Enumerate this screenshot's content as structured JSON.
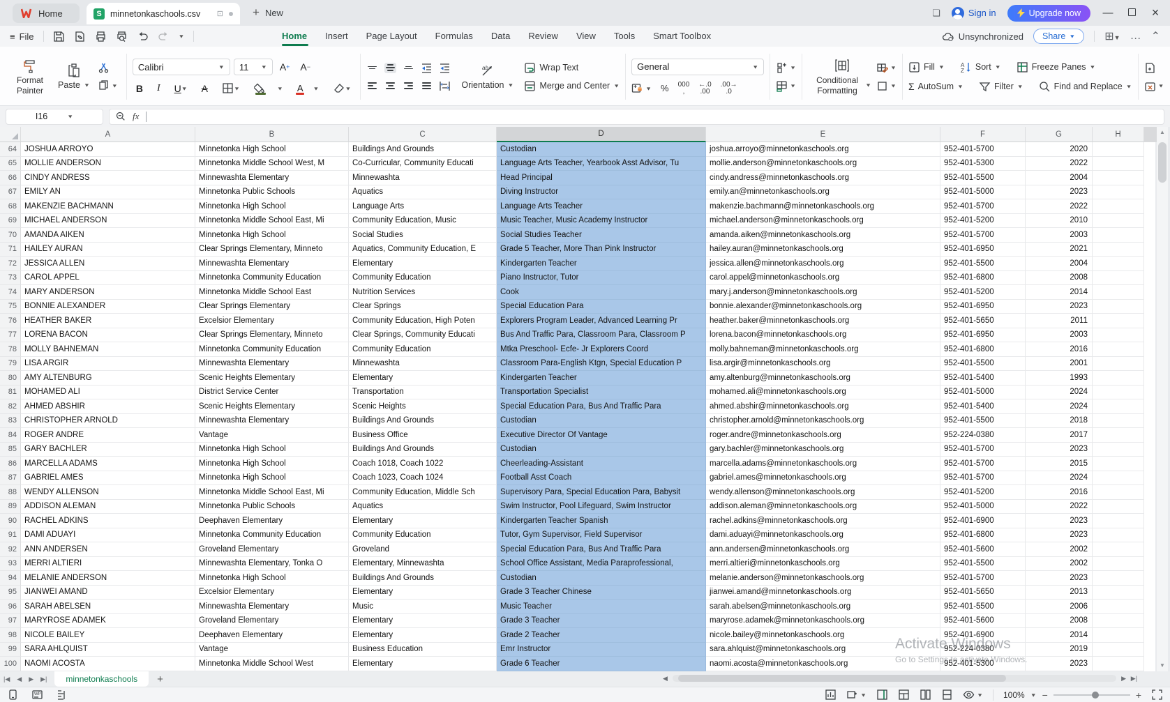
{
  "titlebar": {
    "home_tab": "Home",
    "doc_tab": "minnetonkaschools.csv",
    "new_label": "New",
    "sign_in": "Sign in",
    "upgrade": "Upgrade now"
  },
  "menubar": {
    "file": "File",
    "tabs": [
      "Home",
      "Insert",
      "Page Layout",
      "Formulas",
      "Data",
      "Review",
      "View",
      "Tools",
      "Smart Toolbox"
    ],
    "active_tab": "Home",
    "sync_status": "Unsynchronized",
    "share": "Share"
  },
  "ribbon": {
    "format_painter": "Format Painter",
    "paste": "Paste",
    "font_name": "Calibri",
    "font_size": "11",
    "orientation": "Orientation",
    "wrap_text": "Wrap Text",
    "merge_center": "Merge and Center",
    "number_format": "General",
    "percent": "%",
    "thousands": "000",
    "dec_decrease": "←.0",
    "dec_increase": ".00→",
    "conditional_formatting": "Conditional Formatting",
    "fill": "Fill",
    "autosum": "AutoSum",
    "sort": "Sort",
    "filter": "Filter",
    "freeze_panes": "Freeze Panes",
    "find_replace": "Find and Replace",
    "bold": "B",
    "italic": "I",
    "underline": "U",
    "strike": "A",
    "font_grow": "A+",
    "font_shrink": "A-",
    "sigma": "Σ"
  },
  "formula_bar": {
    "name_box": "I16"
  },
  "grid": {
    "columns": [
      "A",
      "B",
      "C",
      "D",
      "E",
      "F",
      "G",
      "H"
    ],
    "selected_column": "D",
    "rows": [
      [
        "64",
        "JOSHUA ARROYO",
        "Minnetonka High School",
        "Buildings And Grounds",
        "Custodian",
        "joshua.arroyo@minnetonkaschools.org",
        "952-401-5700",
        "2020"
      ],
      [
        "65",
        "MOLLIE ANDERSON",
        "Minnetonka Middle School West, M",
        "Co-Curricular, Community Educati",
        "Language Arts Teacher, Yearbook Asst Advisor, Tu",
        "mollie.anderson@minnetonkaschools.org",
        "952-401-5300",
        "2022"
      ],
      [
        "66",
        "CINDY ANDRESS",
        "Minnewashta Elementary",
        "Minnewashta",
        "Head Principal",
        "cindy.andress@minnetonkaschools.org",
        "952-401-5500",
        "2004"
      ],
      [
        "67",
        "EMILY AN",
        "Minnetonka Public Schools",
        "Aquatics",
        "Diving Instructor",
        "emily.an@minnetonkaschools.org",
        "952-401-5000",
        "2023"
      ],
      [
        "68",
        "MAKENZIE BACHMANN",
        "Minnetonka High School",
        "Language Arts",
        "Language Arts Teacher",
        "makenzie.bachmann@minnetonkaschools.org",
        "952-401-5700",
        "2022"
      ],
      [
        "69",
        "MICHAEL ANDERSON",
        "Minnetonka Middle School East, Mi",
        "Community Education, Music",
        "Music Teacher, Music Academy Instructor",
        "michael.anderson@minnetonkaschools.org",
        "952-401-5200",
        "2010"
      ],
      [
        "70",
        "AMANDA AIKEN",
        "Minnetonka High School",
        "Social Studies",
        "Social Studies Teacher",
        "amanda.aiken@minnetonkaschools.org",
        "952-401-5700",
        "2003"
      ],
      [
        "71",
        "HAILEY AURAN",
        "Clear Springs Elementary, Minneto",
        "Aquatics, Community Education, E",
        "Grade 5 Teacher, More Than Pink Instructor",
        "hailey.auran@minnetonkaschools.org",
        "952-401-6950",
        "2021"
      ],
      [
        "72",
        "JESSICA ALLEN",
        "Minnewashta Elementary",
        "Elementary",
        "Kindergarten Teacher",
        "jessica.allen@minnetonkaschools.org",
        "952-401-5500",
        "2004"
      ],
      [
        "73",
        "CAROL APPEL",
        "Minnetonka Community Education",
        "Community Education",
        "Piano Instructor, Tutor",
        "carol.appel@minnetonkaschools.org",
        "952-401-6800",
        "2008"
      ],
      [
        "74",
        "MARY ANDERSON",
        "Minnetonka Middle School East",
        "Nutrition Services",
        "Cook",
        "mary.j.anderson@minnetonkaschools.org",
        "952-401-5200",
        "2014"
      ],
      [
        "75",
        "BONNIE ALEXANDER",
        "Clear Springs Elementary",
        "Clear Springs",
        "Special Education Para",
        "bonnie.alexander@minnetonkaschools.org",
        "952-401-6950",
        "2023"
      ],
      [
        "76",
        "HEATHER BAKER",
        "Excelsior Elementary",
        "Community Education, High Poten",
        "Explorers Program Leader, Advanced Learning Pr",
        "heather.baker@minnetonkaschools.org",
        "952-401-5650",
        "2011"
      ],
      [
        "77",
        "LORENA BACON",
        "Clear Springs Elementary, Minneto",
        "Clear Springs, Community Educati",
        "Bus And Traffic Para, Classroom Para, Classroom P",
        "lorena.bacon@minnetonkaschools.org",
        "952-401-6950",
        "2003"
      ],
      [
        "78",
        "MOLLY BAHNEMAN",
        "Minnetonka Community Education",
        "Community Education",
        "Mtka Preschool- Ecfe- Jr Explorers Coord",
        "molly.bahneman@minnetonkaschools.org",
        "952-401-6800",
        "2016"
      ],
      [
        "79",
        "LISA ARGIR",
        "Minnewashta Elementary",
        "Minnewashta",
        "Classroom Para-English Ktgn, Special Education P",
        "lisa.argir@minnetonkaschools.org",
        "952-401-5500",
        "2001"
      ],
      [
        "80",
        "AMY ALTENBURG",
        "Scenic Heights Elementary",
        "Elementary",
        "Kindergarten Teacher",
        "amy.altenburg@minnetonkaschools.org",
        "952-401-5400",
        "1993"
      ],
      [
        "81",
        "MOHAMED ALI",
        "District Service Center",
        "Transportation",
        "Transportation Specialist",
        "mohamed.ali@minnetonkaschools.org",
        "952-401-5000",
        "2024"
      ],
      [
        "82",
        "AHMED ABSHIR",
        "Scenic Heights Elementary",
        "Scenic Heights",
        "Special Education Para, Bus And Traffic Para",
        "ahmed.abshir@minnetonkaschools.org",
        "952-401-5400",
        "2024"
      ],
      [
        "83",
        "CHRISTOPHER ARNOLD",
        "Minnewashta Elementary",
        "Buildings And Grounds",
        "Custodian",
        "christopher.arnold@minnetonkaschools.org",
        "952-401-5500",
        "2018"
      ],
      [
        "84",
        "ROGER ANDRE",
        "Vantage",
        "Business Office",
        "Executive Director Of Vantage",
        "roger.andre@minnetonkaschools.org",
        "952-224-0380",
        "2017"
      ],
      [
        "85",
        "GARY BACHLER",
        "Minnetonka High School",
        "Buildings And Grounds",
        "Custodian",
        "gary.bachler@minnetonkaschools.org",
        "952-401-5700",
        "2023"
      ],
      [
        "86",
        "MARCELLA ADAMS",
        "Minnetonka High School",
        "Coach 1018, Coach 1022",
        "Cheerleading-Assistant",
        "marcella.adams@minnetonkaschools.org",
        "952-401-5700",
        "2015"
      ],
      [
        "87",
        "GABRIEL AMES",
        "Minnetonka High School",
        "Coach 1023, Coach 1024",
        "Football Asst Coach",
        "gabriel.ames@minnetonkaschools.org",
        "952-401-5700",
        "2024"
      ],
      [
        "88",
        "WENDY ALLENSON",
        "Minnetonka Middle School East, Mi",
        "Community Education, Middle Sch",
        "Supervisory Para, Special Education Para, Babysit",
        "wendy.allenson@minnetonkaschools.org",
        "952-401-5200",
        "2016"
      ],
      [
        "89",
        "ADDISON ALEMAN",
        "Minnetonka Public Schools",
        "Aquatics",
        "Swim Instructor, Pool Lifeguard, Swim Instructor",
        "addison.aleman@minnetonkaschools.org",
        "952-401-5000",
        "2022"
      ],
      [
        "90",
        "RACHEL ADKINS",
        "Deephaven Elementary",
        "Elementary",
        "Kindergarten Teacher Spanish",
        "rachel.adkins@minnetonkaschools.org",
        "952-401-6900",
        "2023"
      ],
      [
        "91",
        "DAMI ADUAYI",
        "Minnetonka Community Education",
        "Community Education",
        "Tutor, Gym Supervisor, Field Supervisor",
        "dami.aduayi@minnetonkaschools.org",
        "952-401-6800",
        "2023"
      ],
      [
        "92",
        "ANN ANDERSEN",
        "Groveland Elementary",
        "Groveland",
        "Special Education Para, Bus And Traffic Para",
        "ann.andersen@minnetonkaschools.org",
        "952-401-5600",
        "2002"
      ],
      [
        "93",
        "MERRI ALTIERI",
        "Minnewashta Elementary, Tonka O",
        "Elementary, Minnewashta",
        "School Office Assistant, Media Paraprofessional,",
        "merri.altieri@minnetonkaschools.org",
        "952-401-5500",
        "2002"
      ],
      [
        "94",
        "MELANIE ANDERSON",
        "Minnetonka High School",
        "Buildings And Grounds",
        "Custodian",
        "melanie.anderson@minnetonkaschools.org",
        "952-401-5700",
        "2023"
      ],
      [
        "95",
        "JIANWEI AMAND",
        "Excelsior Elementary",
        "Elementary",
        "Grade 3 Teacher Chinese",
        "jianwei.amand@minnetonkaschools.org",
        "952-401-5650",
        "2013"
      ],
      [
        "96",
        "SARAH ABELSEN",
        "Minnewashta Elementary",
        "Music",
        "Music Teacher",
        "sarah.abelsen@minnetonkaschools.org",
        "952-401-5500",
        "2006"
      ],
      [
        "97",
        "MARYROSE ADAMEK",
        "Groveland Elementary",
        "Elementary",
        "Grade 3 Teacher",
        "maryrose.adamek@minnetonkaschools.org",
        "952-401-5600",
        "2008"
      ],
      [
        "98",
        "NICOLE BAILEY",
        "Deephaven Elementary",
        "Elementary",
        "Grade 2 Teacher",
        "nicole.bailey@minnetonkaschools.org",
        "952-401-6900",
        "2014"
      ],
      [
        "99",
        "SARA AHLQUIST",
        "Vantage",
        "Business Education",
        "Emr Instructor",
        "sara.ahlquist@minnetonkaschools.org",
        "952-224-0380",
        "2019"
      ],
      [
        "100",
        "NAOMI ACOSTA",
        "Minnetonka Middle School West",
        "Elementary",
        "Grade 6 Teacher",
        "naomi.acosta@minnetonkaschools.org",
        "952-401-5300",
        "2023"
      ]
    ]
  },
  "sheet_bar": {
    "tab": "minnetonkaschools"
  },
  "status_bar": {
    "zoom": "100%"
  },
  "watermark": {
    "line1": "Activate Windows",
    "line2": "Go to Settings to activate Windows."
  },
  "colors": {
    "accent_green": "#0e7c4f",
    "selection_blue": "#a9c7e8",
    "upgrade_gradient": [
      "#3d7bfa",
      "#8a52f5"
    ]
  }
}
